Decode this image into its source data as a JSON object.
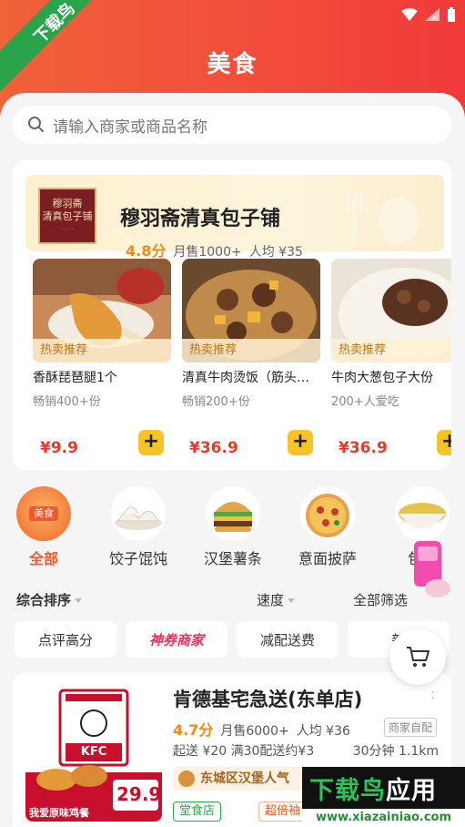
{
  "watermark_corner": "下载鸟",
  "header": {
    "title": "美食"
  },
  "search": {
    "placeholder": "请输入商家或商品名称"
  },
  "featured_store": {
    "logo_text_line1": "穆羽斋",
    "logo_text_line2": "清真包子铺",
    "name": "穆羽斋清真包子铺",
    "rating": "4.8分",
    "sales": "月售1000+",
    "avg_price": "人均 ¥35",
    "items": [
      {
        "tag": "热卖推荐",
        "name": "香酥琵琶腿1个",
        "sales": "畅销400+份",
        "price": "¥9.9"
      },
      {
        "tag": "热卖推荐",
        "name": "清真牛肉烫饭（筋头…",
        "sales": "畅销200+份",
        "price": "¥36.9"
      },
      {
        "tag": "热卖推荐",
        "name": "牛肉大葱包子大份",
        "sales": "200+人爱吃",
        "price": "¥36.9"
      }
    ],
    "add_symbol": "+"
  },
  "categories": [
    {
      "label": "全部",
      "chip": "美食",
      "active": true
    },
    {
      "label": "饺子馄饨"
    },
    {
      "label": "汉堡薯条"
    },
    {
      "label": "意面披萨"
    },
    {
      "label": "包子"
    }
  ],
  "sort": {
    "primary": "综合排序",
    "speed": "速度",
    "filter": "全部筛选"
  },
  "filters": [
    "点评高分",
    "神券商家",
    "减配送费",
    "新"
  ],
  "kfc_store": {
    "name": "肯德基宅急送(东单店)",
    "rating": "4.7分",
    "sales": "月售6000+",
    "avg_price": "人均 ¥36",
    "delivery_badge": "商家自配",
    "delivery_info": "起送 ¥20  满30配送约¥3",
    "eta": "30分钟  1.1km",
    "rank": "东城区汉堡人气",
    "tag_1": "堂食店",
    "tag_2": "超倍袖",
    "promo_text": "我爱原味鸡餐",
    "promo_price": "29.9",
    "logo_text": "KFC"
  },
  "site_watermark": {
    "brand": "下载鸟",
    "suffix": "应用",
    "url": "www.xiazainiao.com"
  },
  "colors": {
    "accent": "#f24b3b",
    "price": "#e8392b",
    "rating": "#f28a1a",
    "add_button": "#f7c325"
  }
}
